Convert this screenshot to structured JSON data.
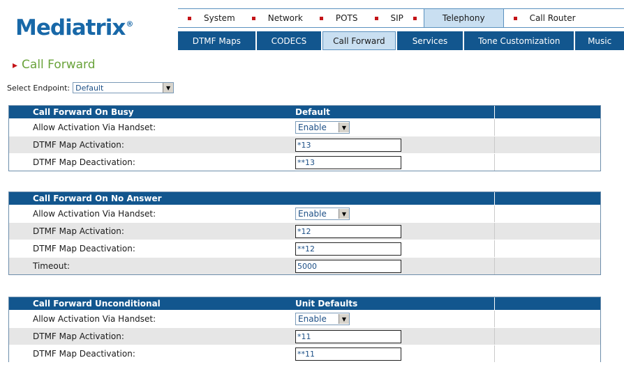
{
  "logo": {
    "text": "Mediatrix",
    "reg": "®"
  },
  "nav_primary": [
    {
      "label": "System"
    },
    {
      "label": "Network"
    },
    {
      "label": "POTS"
    },
    {
      "label": "SIP"
    },
    {
      "label": "Telephony",
      "active": true
    },
    {
      "label": "Call Router"
    }
  ],
  "nav_secondary": [
    {
      "label": "DTMF Maps"
    },
    {
      "label": "CODECS"
    },
    {
      "label": "Call Forward",
      "active": true
    },
    {
      "label": "Services"
    },
    {
      "label": "Tone Customization"
    },
    {
      "label": "Music"
    }
  ],
  "page": {
    "title": "Call Forward"
  },
  "endpoint": {
    "label": "Select Endpoint:",
    "value": "Default"
  },
  "sections": [
    {
      "title": "Call Forward On Busy",
      "column": "Default",
      "rows": [
        {
          "label": "Allow Activation Via Handset:",
          "type": "select",
          "value": "Enable"
        },
        {
          "label": "DTMF Map Activation:",
          "type": "input",
          "value": "*13"
        },
        {
          "label": "DTMF Map Deactivation:",
          "type": "input",
          "value": "**13"
        }
      ]
    },
    {
      "title": "Call Forward On No Answer",
      "column": "",
      "rows": [
        {
          "label": "Allow Activation Via Handset:",
          "type": "select",
          "value": "Enable"
        },
        {
          "label": "DTMF Map Activation:",
          "type": "input",
          "value": "*12"
        },
        {
          "label": "DTMF Map Deactivation:",
          "type": "input",
          "value": "**12"
        },
        {
          "label": "Timeout:",
          "type": "input",
          "value": "5000"
        }
      ]
    },
    {
      "title": "Call Forward Unconditional",
      "column": "Unit Defaults",
      "rows": [
        {
          "label": "Allow Activation Via Handset:",
          "type": "select",
          "value": "Enable"
        },
        {
          "label": "DTMF Map Activation:",
          "type": "input",
          "value": "*11"
        },
        {
          "label": "DTMF Map Deactivation:",
          "type": "input",
          "value": "**11"
        }
      ]
    }
  ],
  "colors": {
    "nav_dark": "#12568e",
    "nav_active": "#c9dff1",
    "title_green": "#6aa33b",
    "bullet_red": "#c41418",
    "row_shade": "#e6e6e6"
  },
  "icons": {
    "bullet": "red-square-icon",
    "title_arrow": "chevron-right-icon",
    "dropdown": "dropdown-arrow-icon"
  }
}
